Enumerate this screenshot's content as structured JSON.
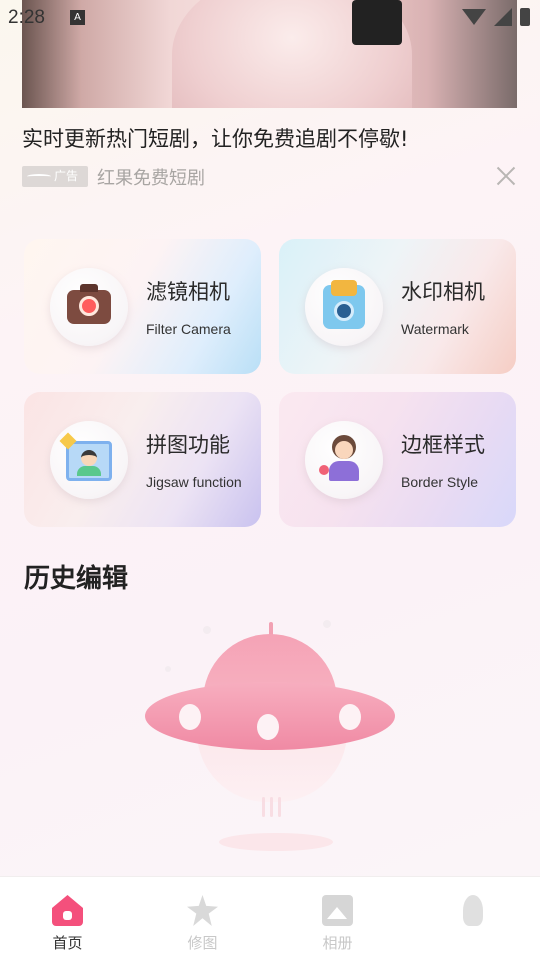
{
  "status_bar": {
    "time": "2:28",
    "notification_letter": "A"
  },
  "ad": {
    "title": "实时更新热门短剧，让你免费追剧不停歇!",
    "tag": "广告",
    "source": "红果免费短剧"
  },
  "features": [
    {
      "title": "滤镜相机",
      "subtitle": "Filter Camera",
      "icon": "camera-heart-icon"
    },
    {
      "title": "水印相机",
      "subtitle": "Watermark",
      "icon": "instant-camera-icon"
    },
    {
      "title": "拼图功能",
      "subtitle": "Jigsaw function",
      "icon": "jigsaw-photo-icon"
    },
    {
      "title": "边框样式",
      "subtitle": "Border Style",
      "icon": "portrait-frame-icon"
    }
  ],
  "history": {
    "title": "历史编辑",
    "empty_illustration": "ufo-illustration"
  },
  "bottom_nav": [
    {
      "label": "首页",
      "icon": "home-icon",
      "active": true
    },
    {
      "label": "修图",
      "icon": "edit-star-icon",
      "active": false
    },
    {
      "label": "相册",
      "icon": "album-icon",
      "active": false
    },
    {
      "label": "",
      "icon": "bulb-icon",
      "active": false
    }
  ],
  "colors": {
    "accent": "#f4507c",
    "ufo_pink": "#f08aa4"
  }
}
